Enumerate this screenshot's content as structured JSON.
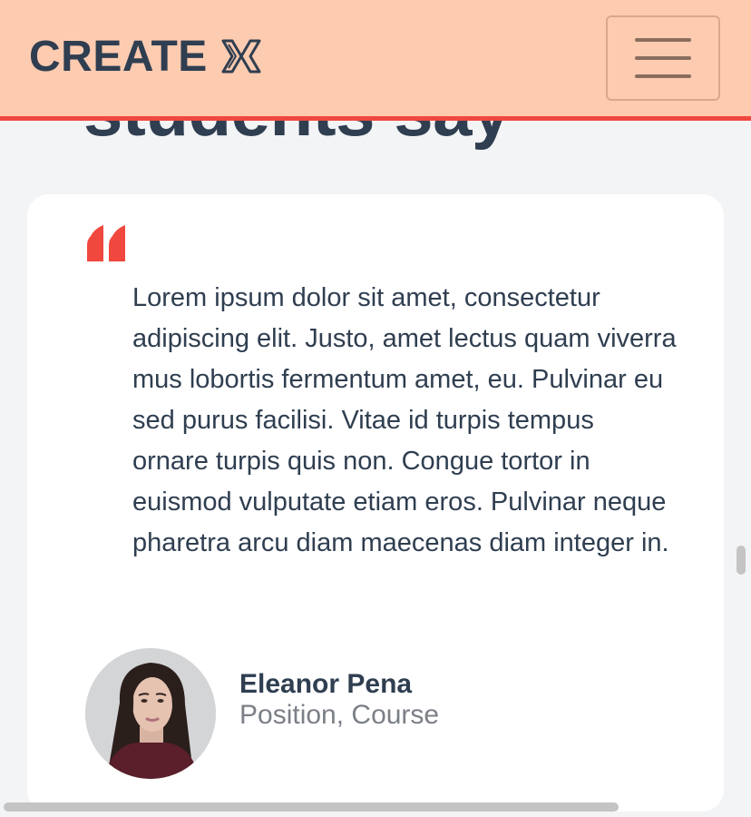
{
  "section": {
    "heading": "students say"
  },
  "header": {
    "logo_text": "CREATE",
    "logo_mark_icon": "create-x-mark-icon",
    "menu_icon": "hamburger-menu-icon",
    "background_color": "#fdcbb0",
    "border_color": "#f0483e"
  },
  "testimonial": {
    "quote_icon": "quote-mark-icon",
    "quote_color": "#f0483e",
    "text": "Lorem ipsum dolor sit amet, consectetur adipiscing elit. Justo, amet lectus quam viverra mus lobortis fermentum amet, eu. Pulvinar eu sed purus facilisi. Vitae id turpis tempus ornare turpis quis non. Congue tortor in euismod vulputate etiam eros. Pulvinar neque pharetra arcu diam maecenas diam integer in.",
    "author": {
      "name": "Eleanor Pena",
      "position": "Position, Course",
      "avatar_icon": "avatar-photo"
    }
  },
  "colors": {
    "text_dark": "#2f3e50",
    "text_muted": "#7b7f86",
    "page_background": "#f3f4f6"
  }
}
